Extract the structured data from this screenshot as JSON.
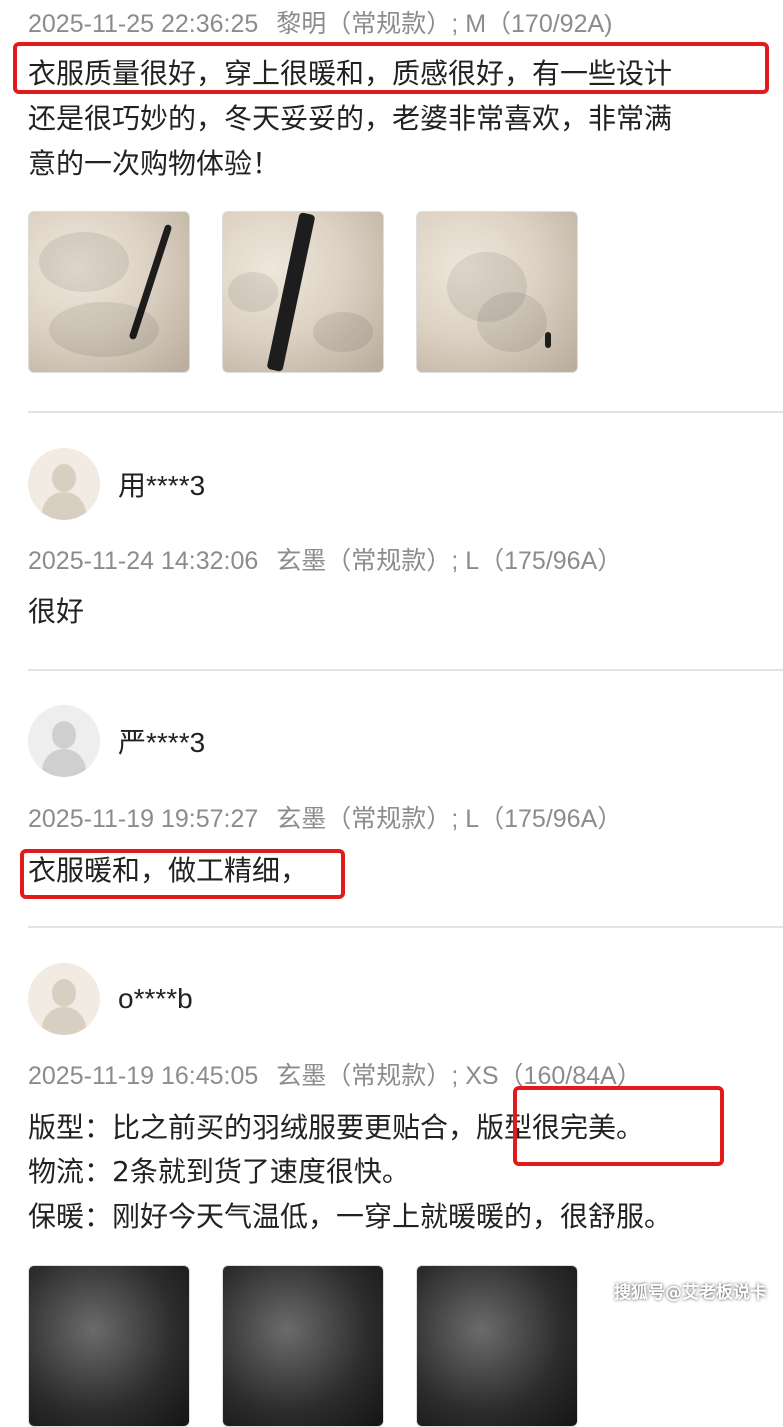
{
  "reviews": [
    {
      "meta": {
        "time": "2025-11-25 22:36:25",
        "color": "黎明（常规款）",
        "size": "; M（170/92A)"
      },
      "lines": [
        "衣服质量很好，穿上很暖和，质感很好，有一些设计",
        "还是很巧妙的，冬天妥妥的，老婆非常喜欢，非常满",
        "意的一次购物体验！"
      ],
      "photos": [
        "photo-1",
        "photo-2",
        "photo-3"
      ]
    },
    {
      "user": "用****3",
      "meta": {
        "time": "2025-11-24 14:32:06",
        "color": "玄墨（常规款）",
        "size": "; L（175/96A）"
      },
      "lines": [
        "很好"
      ]
    },
    {
      "user": "严****3",
      "meta": {
        "time": "2025-11-19 19:57:27",
        "color": "玄墨（常规款）",
        "size": "; L（175/96A）"
      },
      "lines": [
        "衣服暖和，做工精细，"
      ]
    },
    {
      "user": "o****b",
      "meta": {
        "time": "2025-11-19 16:45:05",
        "color": "玄墨（常规款）",
        "size": "; XS（160/84A）"
      },
      "lines": [
        "版型：比之前买的羽绒服要更贴合，版型很完美。",
        "物流：2条就到货了速度很快。",
        "保暖：刚好今天气温低，一穿上就暖暖的，很舒服。"
      ]
    }
  ],
  "watermark": "搜狐号@艾老板说卡",
  "colors": {
    "highlight": "#e21a1a",
    "meta_text": "#8c8c8c",
    "divider": "#e3e3e3"
  }
}
